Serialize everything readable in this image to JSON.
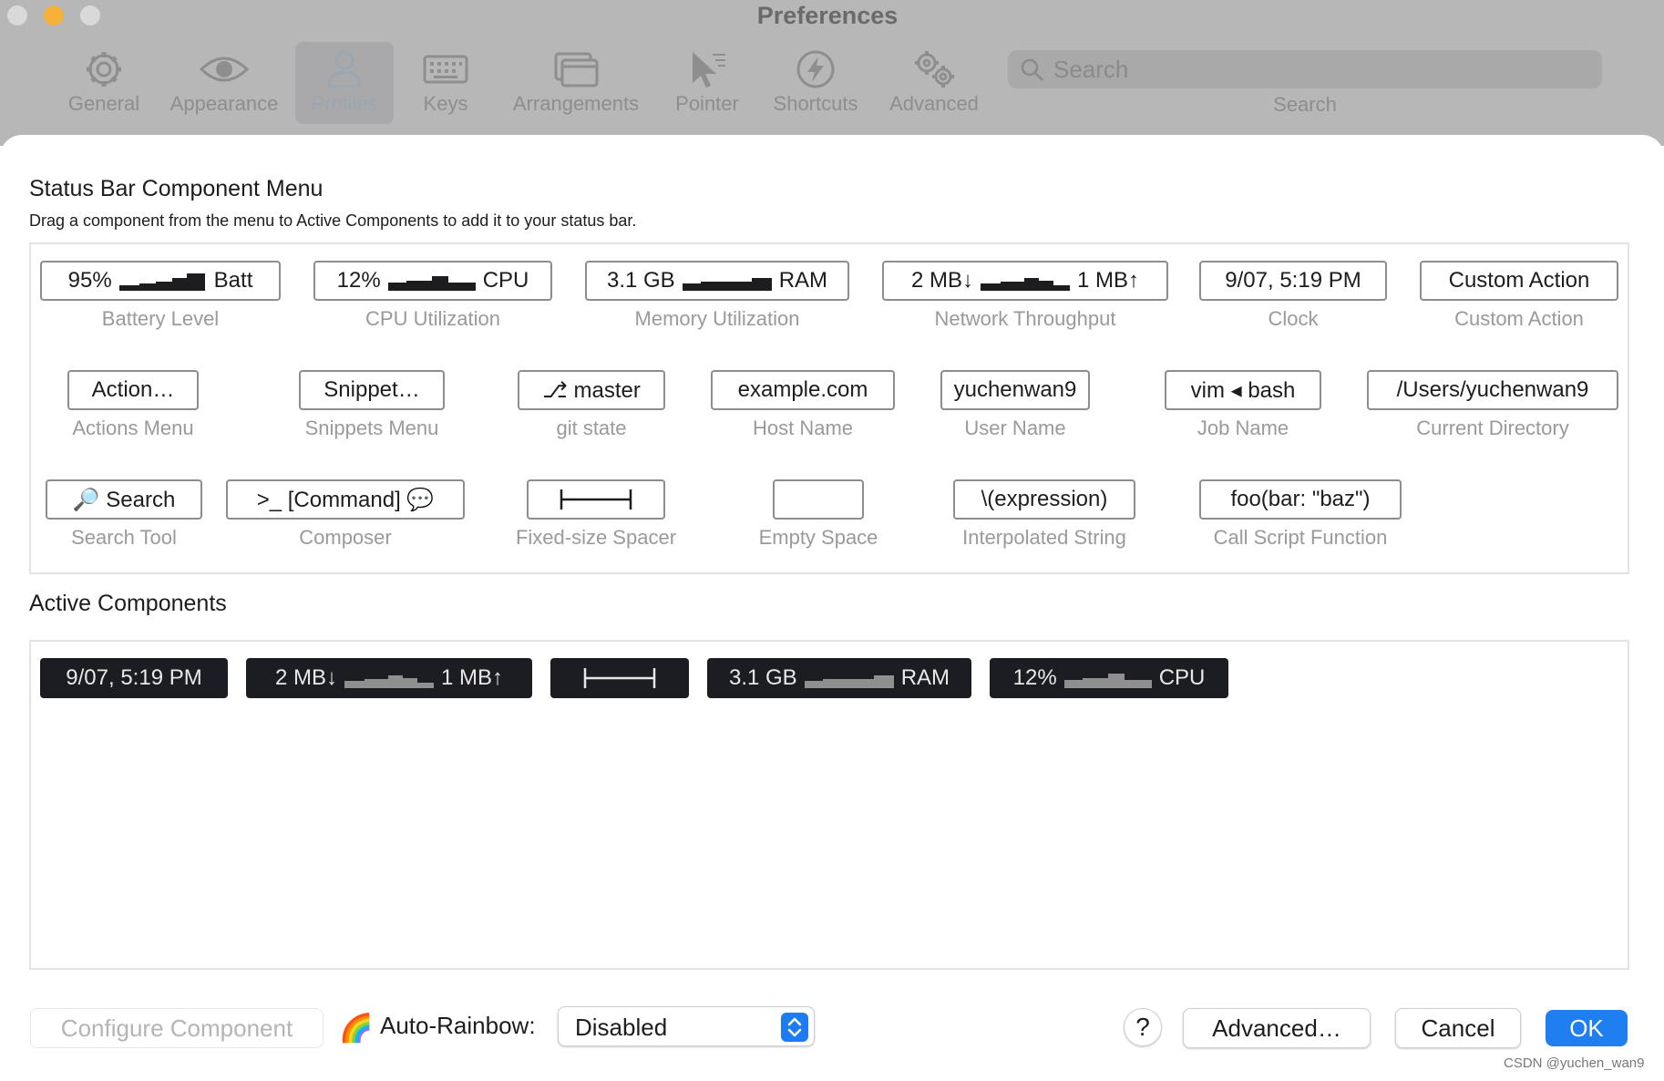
{
  "window": {
    "title": "Preferences"
  },
  "toolbar": {
    "items": [
      {
        "label": "General",
        "icon": "gear-icon"
      },
      {
        "label": "Appearance",
        "icon": "eye-icon"
      },
      {
        "label": "Profiles",
        "icon": "person-icon",
        "selected": true
      },
      {
        "label": "Keys",
        "icon": "keyboard-icon"
      },
      {
        "label": "Arrangements",
        "icon": "windows-icon"
      },
      {
        "label": "Pointer",
        "icon": "pointer-icon"
      },
      {
        "label": "Shortcuts",
        "icon": "bolt-icon"
      },
      {
        "label": "Advanced",
        "icon": "gears-icon"
      }
    ],
    "search": {
      "placeholder": "Search",
      "label": "Search"
    }
  },
  "menu": {
    "title": "Status Bar Component Menu",
    "subtitle": "Drag a component from the menu to Active Components to add it to your status bar.",
    "components": [
      {
        "id": "battery",
        "pre": "95%",
        "post": "Batt",
        "label": "Battery Level"
      },
      {
        "id": "cpu",
        "pre": "12%",
        "post": "CPU",
        "label": "CPU Utilization"
      },
      {
        "id": "memory",
        "pre": "3.1 GB",
        "post": "RAM",
        "label": "Memory Utilization"
      },
      {
        "id": "network",
        "pre": "2 MB↓",
        "post": "1 MB↑",
        "label": "Network Throughput"
      },
      {
        "id": "clock",
        "text": "9/07, 5:19 PM",
        "label": "Clock"
      },
      {
        "id": "custom-action",
        "text": "Custom Action",
        "label": "Custom Action"
      },
      {
        "id": "actions-menu",
        "text": "Action…",
        "label": "Actions Menu"
      },
      {
        "id": "snippets-menu",
        "text": "Snippet…",
        "label": "Snippets Menu"
      },
      {
        "id": "git",
        "text": "⎇ master",
        "label": "git state"
      },
      {
        "id": "host",
        "text": "example.com",
        "label": "Host Name"
      },
      {
        "id": "user",
        "text": "yuchenwan9",
        "label": "User Name"
      },
      {
        "id": "job",
        "text": "vim ◂ bash",
        "label": "Job Name"
      },
      {
        "id": "dir",
        "text": "/Users/yuchenwan9",
        "label": "Current Directory"
      },
      {
        "id": "search-tool",
        "text": "🔎 Search",
        "label": "Search Tool"
      },
      {
        "id": "composer",
        "text": ">_ [Command] 💬",
        "label": "Composer"
      },
      {
        "id": "spacer",
        "text": "",
        "label": "Fixed-size Spacer"
      },
      {
        "id": "empty",
        "text": "",
        "label": "Empty Space"
      },
      {
        "id": "interp",
        "text": "\\(expression)",
        "label": "Interpolated String"
      },
      {
        "id": "script",
        "text": "foo(bar: \"baz\")",
        "label": "Call Script Function"
      }
    ]
  },
  "active": {
    "title": "Active Components",
    "items": [
      {
        "id": "clock",
        "text": "9/07, 5:19 PM"
      },
      {
        "id": "network",
        "pre": "2 MB↓",
        "post": "1 MB↑"
      },
      {
        "id": "spacer",
        "text": ""
      },
      {
        "id": "memory",
        "pre": "3.1 GB",
        "post": "RAM"
      },
      {
        "id": "cpu",
        "pre": "12%",
        "post": "CPU"
      }
    ]
  },
  "footer": {
    "configure_label": "Configure Component",
    "rainbow_icon": "🌈",
    "rainbow_label": "Auto-Rainbow:",
    "rainbow_value": "Disabled",
    "help_label": "?",
    "advanced_label": "Advanced…",
    "cancel_label": "Cancel",
    "ok_label": "OK"
  },
  "watermark": "CSDN @yuchen_wan9",
  "colors": {
    "accent": "#1f7ff1",
    "active_chip": "#1c1d22",
    "toolbar_bg": "#b7b7b7"
  }
}
